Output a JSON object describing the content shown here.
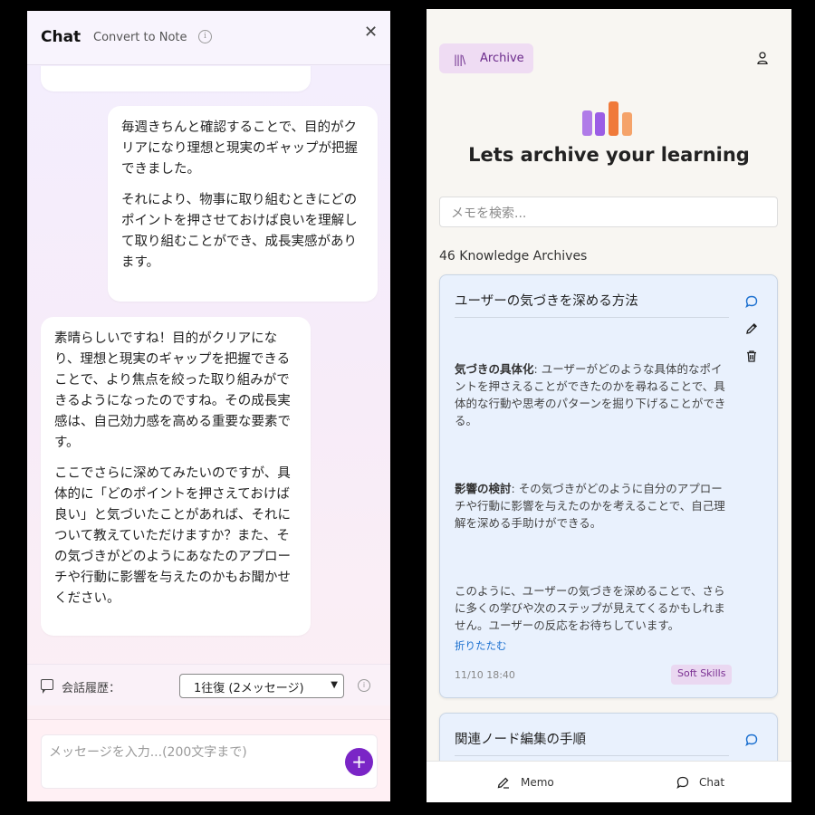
{
  "chat": {
    "title": "Chat",
    "convert_label": "Convert to Note",
    "messages": [
      {
        "role": "user",
        "paragraphs": [
          "毎週きちんと確認することで、目的がクリアになり理想と現実のギャップが把握できました。",
          "それにより、物事に取り組むときにどのポイントを押させておけば良いを理解して取り組むことができ、成長実感があります。"
        ]
      },
      {
        "role": "assistant",
        "paragraphs": [
          "素晴らしいですね！目的がクリアになり、理想と現実のギャップを把握できることで、より焦点を絞った取り組みができるようになったのですね。その成長実感は、自己効力感を高める重要な要素です。",
          "ここでさらに深めてみたいのですが、具体的に「どのポイントを押さえておけば良い」と気づいたことがあれば、それについて教えていただけますか？また、その気づきがどのようにあなたのアプローチや行動に影響を与えたのかもお聞かせください。"
        ]
      }
    ],
    "history_label": "会話履歴：",
    "history_selected": "1往復 (2メッセージ)",
    "input_placeholder": "メッセージを入力...(200文字まで)",
    "send_label": "+"
  },
  "archive": {
    "tab_label": "Archive",
    "heading": "Lets archive your learning",
    "search_placeholder": "メモを検索...",
    "count_label": "46 Knowledge Archives",
    "cards": [
      {
        "title": "ユーザーの気づきを深める方法",
        "sections": [
          {
            "bold": "気づきの具体化",
            "text": ": ユーザーがどのような具体的なポイントを押さえることができたのかを尋ねることで、具体的な行動や思考のパターンを掘り下げることができる。"
          },
          {
            "bold": "影響の検討",
            "text": ": その気づきがどのように自分のアプローチや行動に影響を与えたのかを考えることで、自己理解を深める手助けができる。"
          },
          {
            "bold": "",
            "text": "このように、ユーザーの気づきを深めることで、さらに多くの学びや次のステップが見えてくるかもしれません。ユーザーの反応をお待ちしています。"
          }
        ],
        "collapse_label": "折りたたむ",
        "date": "11/10 18:40",
        "tag": "Soft Skills"
      },
      {
        "title": "関連ノード編集の手順"
      }
    ],
    "nav": {
      "memo_label": "Memo",
      "chat_label": "Chat"
    },
    "logo_colors": [
      "#b07be8",
      "#9b5de5",
      "#f07a3a",
      "#f5a36a"
    ]
  }
}
